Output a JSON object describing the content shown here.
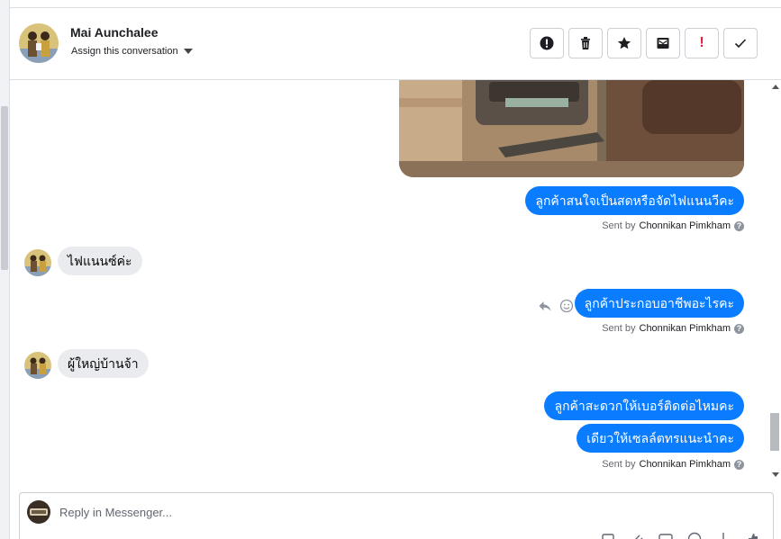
{
  "header": {
    "contact_name": "Mai Aunchalee",
    "assign_label": "Assign this conversation",
    "actions": [
      {
        "icon": "alert-circle-icon",
        "label": "!"
      },
      {
        "icon": "trash-icon",
        "label": ""
      },
      {
        "icon": "star-icon",
        "label": ""
      },
      {
        "icon": "inbox-icon",
        "label": ""
      },
      {
        "icon": "exclamation-icon",
        "label": "!"
      },
      {
        "icon": "check-icon",
        "label": ""
      }
    ]
  },
  "thread": {
    "messages": {
      "m1": "ลูกค้าสนใจเป็นสดหรือจัดไฟแนนวีคะ",
      "m2": "ไฟแนนซ์ค่ะ",
      "m3": "ลูกค้าประกอบอาชีพอะไรคะ",
      "m4": "ผู้ใหญ่บ้านจ้า",
      "m5": "ลูกค้าสะดวกให้เบอร์ติดต่อไหมคะ",
      "m6": "เดียวให้เซลล์ตทรแนะนำคะ"
    },
    "sent_by_prefix": "Sent by",
    "agent_name": "Chonnikan Pimkham",
    "help_glyph": "?"
  },
  "composer": {
    "placeholder": "Reply in Messenger..."
  },
  "colors": {
    "outgoing": "#0a7cff",
    "incoming": "#e9ebee",
    "border": "#dadde1"
  }
}
